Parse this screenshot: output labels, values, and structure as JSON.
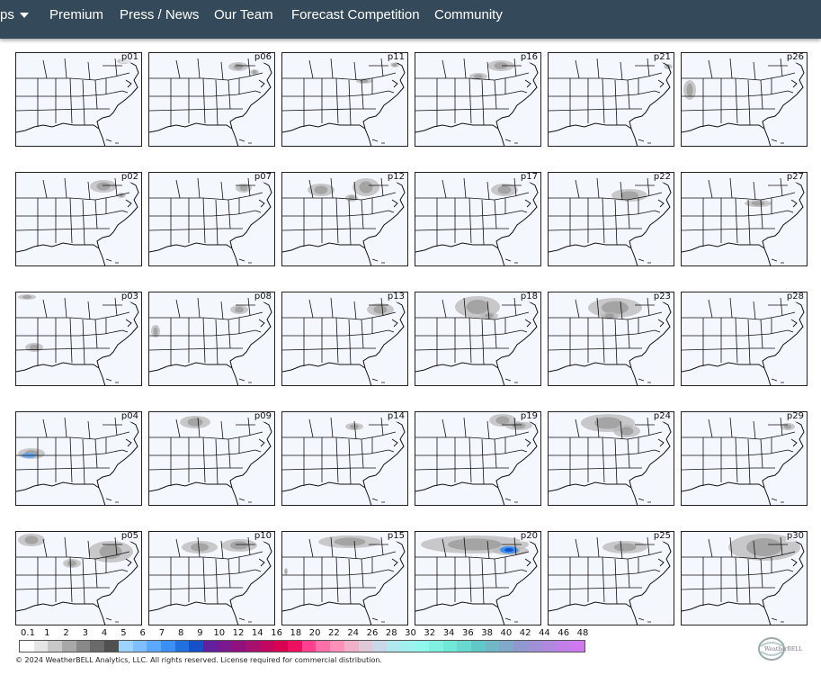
{
  "nav": {
    "partial_item": "ps",
    "items": [
      "Premium",
      "Press / News",
      "Our Team",
      "Forecast Competition",
      "Community"
    ]
  },
  "panels": [
    "p01",
    "p06",
    "p11",
    "p16",
    "p21",
    "p26",
    "p02",
    "p07",
    "p12",
    "p17",
    "p22",
    "p27",
    "p03",
    "p08",
    "p13",
    "p18",
    "p23",
    "p28",
    "p04",
    "p09",
    "p14",
    "p19",
    "p24",
    "p29",
    "p05",
    "p10",
    "p15",
    "p20",
    "p25",
    "p30"
  ],
  "scale": {
    "labels": [
      "0.1",
      "1",
      "2",
      "3",
      "4",
      "5",
      "6",
      "7",
      "8",
      "9",
      "10",
      "12",
      "14",
      "16",
      "18",
      "20",
      "22",
      "24",
      "26",
      "28",
      "30",
      "32",
      "34",
      "36",
      "38",
      "40",
      "42",
      "44",
      "46",
      "48"
    ],
    "colors": [
      "#ffffff",
      "#e6e6e6",
      "#c8c8c8",
      "#a8a8a8",
      "#888888",
      "#6a6a6a",
      "#505050",
      "#9fd3ff",
      "#7fbfff",
      "#5aa8ff",
      "#3b8ff5",
      "#2070e0",
      "#1450c8",
      "#6020a0",
      "#7a1890",
      "#901080",
      "#a81070",
      "#c00860",
      "#d80050",
      "#ee1060",
      "#ff4090",
      "#ff70a8",
      "#ff90b8",
      "#f0b0c8",
      "#e0c8d8",
      "#c8d8e8",
      "#b0e8f0",
      "#a0f0f0",
      "#90f8ec",
      "#80f0e0",
      "#70e8d8",
      "#68d8d0",
      "#60c8c8",
      "#70b8c8",
      "#80a8c8",
      "#9098d0",
      "#a090d8",
      "#b088e0",
      "#c080e8",
      "#d078f0"
    ]
  },
  "footer": {
    "copyright": "© 2024 WeatherBELL Analytics, LLC. All rights reserved. License required for commercial distribution."
  },
  "logo_text": "WeatherBELL"
}
